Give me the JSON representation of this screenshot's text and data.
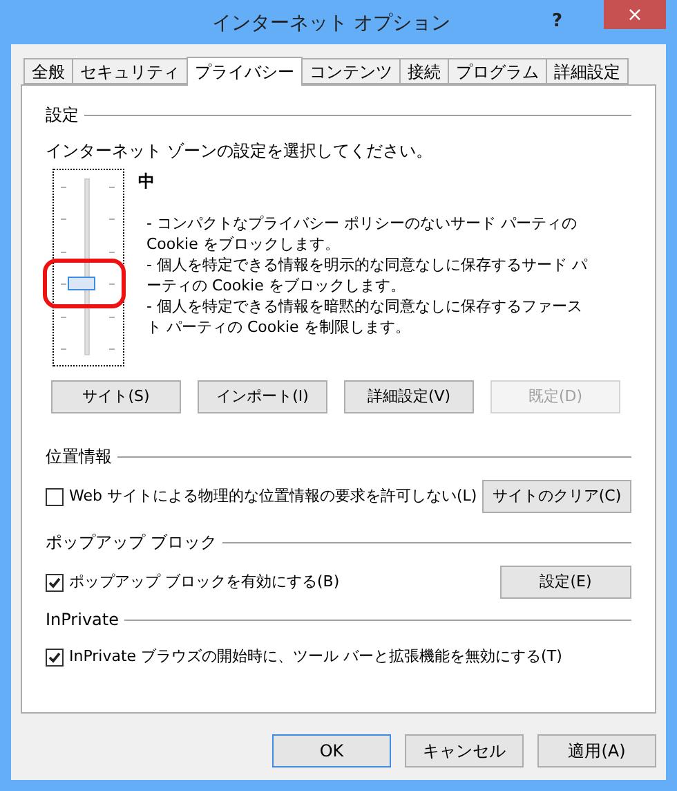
{
  "window": {
    "title": "インターネット オプション",
    "help": "?",
    "close": "×"
  },
  "tabs": [
    {
      "label": "全般",
      "selected": false
    },
    {
      "label": "セキュリティ",
      "selected": false
    },
    {
      "label": "プライバシー",
      "selected": true
    },
    {
      "label": "コンテンツ",
      "selected": false
    },
    {
      "label": "接続",
      "selected": false
    },
    {
      "label": "プログラム",
      "selected": false
    },
    {
      "label": "詳細設定",
      "selected": false
    }
  ],
  "settings": {
    "heading": "設定",
    "instruction": "インターネット ゾーンの設定を選択してください。",
    "slider": {
      "level": 0.4
    },
    "level_name": "中",
    "description": [
      "- コンパクトなプライバシー ポリシーのないサード パーティの Cookie をブロックします。",
      "- 個人を特定できる情報を明示的な同意なしに保存するサード パーティの Cookie をブロックします。",
      "- 個人を特定できる情報を暗黙的な同意なしに保存するファースト パーティの Cookie を制限します。"
    ],
    "buttons": [
      {
        "label": "サイト(S)",
        "disabled": false
      },
      {
        "label": "インポート(I)",
        "disabled": false
      },
      {
        "label": "詳細設定(V)",
        "disabled": false
      },
      {
        "label": "既定(D)",
        "disabled": true
      }
    ]
  },
  "location": {
    "heading": "位置情報",
    "checkbox": {
      "label": "Web サイトによる物理的な位置情報の要求を許可しない(L)",
      "checked": false
    },
    "button": "サイトのクリア(C)"
  },
  "popup": {
    "heading": "ポップアップ ブロック",
    "checkbox": {
      "label": "ポップアップ ブロックを有効にする(B)",
      "checked": true
    },
    "button": "設定(E)"
  },
  "inprivate": {
    "heading": "InPrivate",
    "checkbox": {
      "label": "InPrivate ブラウズの開始時に、ツール バーと拡張機能を無効にする(T)",
      "checked": true
    }
  },
  "footer_buttons": [
    {
      "label": "OK",
      "default": true
    },
    {
      "label": "キャンセル",
      "default": false
    },
    {
      "label": "適用(A)",
      "default": false
    }
  ]
}
